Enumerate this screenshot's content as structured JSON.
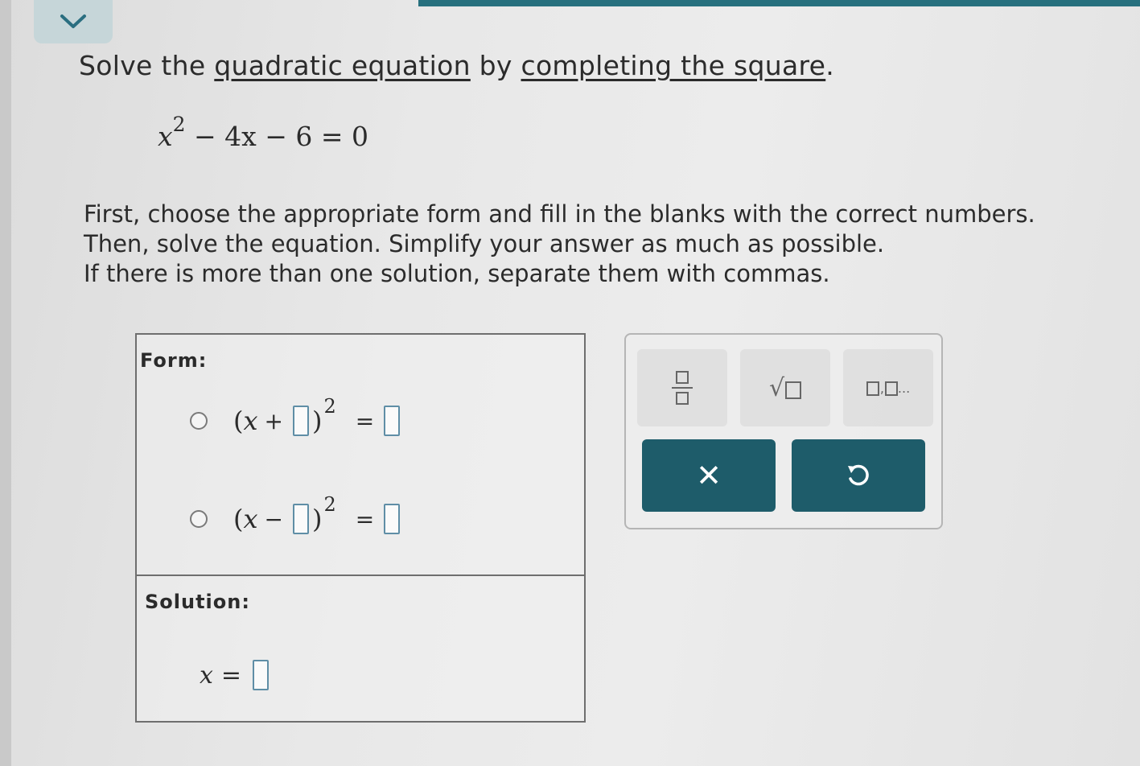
{
  "prompt": {
    "pre": "Solve the ",
    "link1": "quadratic equation",
    "mid": " by ",
    "link2": "completing the square",
    "post": "."
  },
  "equation": {
    "var": "x",
    "exp": "2",
    "rest": " − 4x − 6 = 0"
  },
  "instructions": [
    "First, choose the appropriate form and fill in the blanks with the correct numbers.",
    "Then, solve the equation. Simplify your answer as much as possible.",
    "If there is more than one solution, separate them with commas."
  ],
  "form": {
    "heading": "Form:",
    "options": [
      {
        "open": "(",
        "var": "x",
        "op": "+",
        "close": ")",
        "exp": "2",
        "eq": "="
      },
      {
        "open": "(",
        "var": "x",
        "op": "−",
        "close": ")",
        "exp": "2",
        "eq": "="
      }
    ]
  },
  "solution": {
    "heading": "Solution:",
    "var": "x",
    "eq": "="
  },
  "tools": {
    "fraction": "fraction-icon",
    "sqrt_symbol": "√",
    "sqrt": "square-root-icon",
    "list": "list-icon",
    "list_separator": ",",
    "list_ellipsis": "..."
  },
  "actions": {
    "clear_symbol": "✕",
    "undo": "undo-icon"
  },
  "colors": {
    "accent": "#1e5c6a",
    "top_bar": "#27707e",
    "blank_border": "#5f8ea6"
  }
}
